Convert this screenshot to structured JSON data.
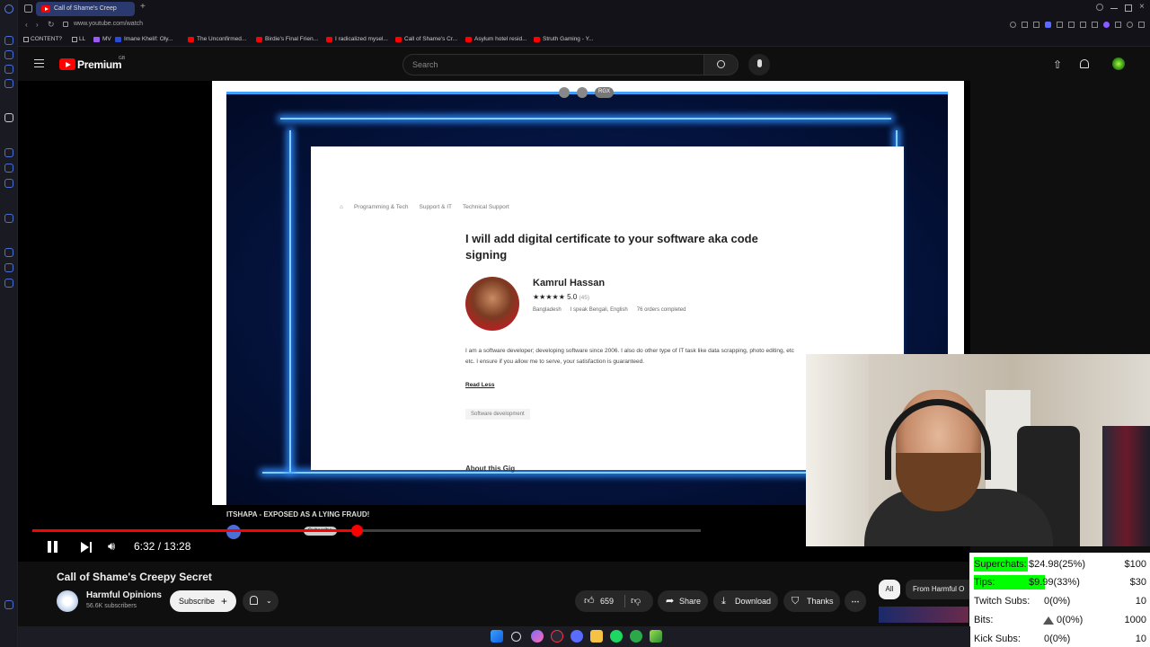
{
  "browser": {
    "tabs": [
      {
        "label": "Call of Shame's Creep",
        "active": true
      }
    ],
    "url": "www.youtube.com/watch",
    "bookmarks": [
      "CONTENT?",
      "LL",
      "MV",
      "Imane Khelif: Oly...",
      "The Unconfirmed...",
      "Birdie's Final Frien...",
      "I radicalized mysel...",
      "Call of Shame's Cr...",
      "Asylum hotel resid...",
      "Struth Gaming - Y..."
    ]
  },
  "youtube": {
    "logo_text": "Premium",
    "region": "GB",
    "search_placeholder": "Search"
  },
  "video": {
    "page": {
      "breadcrumbs": [
        "Programming & Tech",
        "Support & IT",
        "Technical Support"
      ],
      "title": "I will add digital certificate to your software aka code signing",
      "seller_name": "Kamrul Hassan",
      "rating": "5.0",
      "rating_count": "(45)",
      "country": "Bangladesh",
      "languages": "I speak Bengali, English",
      "orders": "76 orders completed",
      "description": "I am a software developer; developing software since 2006. I also do other type of IT task like data scrapping, photo editing, etc etc. I ensure if you allow me to serve, your satisfaction is guaranteed.",
      "read_less": "Read Less",
      "tag": "Software development",
      "section_heading": "About this Gig",
      "toolbar_badge": "RGX"
    },
    "embedded_title": "ITSHAPA - EXPOSED AS A LYING FRAUD!",
    "embedded_subscribe": "Subscribe",
    "time_current": "6:32",
    "time_total": "13:28",
    "time_sep": " / ",
    "progress_fraction": 0.485
  },
  "meta": {
    "title": "Call of Shame's Creepy Secret",
    "channel": "Harmful Opinions",
    "subscribers": "56.6K subscribers",
    "subscribe_label": "Subscribe",
    "likes": "659",
    "share_label": "Share",
    "download_label": "Download",
    "thanks_label": "Thanks",
    "chip_all": "All",
    "chip_from": "From Harmful O"
  },
  "stream_stats": [
    {
      "label": "Superchats:",
      "value": "$24.98(25%)",
      "goal": "$100",
      "fill": 0.25
    },
    {
      "label": "Tips:",
      "value": "$9.99(33%)",
      "goal": "$30",
      "fill": 0.33
    },
    {
      "label": "Twitch Subs:",
      "value": "0(0%)",
      "goal": "10",
      "fill": 0
    },
    {
      "label": "Bits:",
      "value": "0(0%)",
      "goal": "1000",
      "fill": 0
    },
    {
      "label": "Kick Subs:",
      "value": "0(0%)",
      "goal": "10",
      "fill": 0
    }
  ],
  "colors": {
    "yt_red": "#ff0000",
    "stat_fill": "#00ff00"
  }
}
